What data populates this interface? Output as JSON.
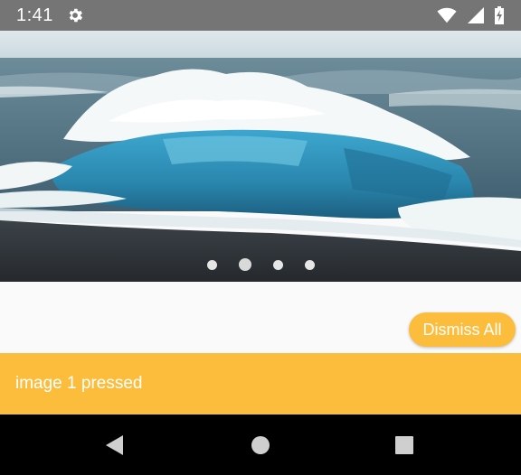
{
  "status_bar": {
    "time": "1:41",
    "icons": [
      "settings-icon",
      "wifi-icon",
      "cellular-signal-icon",
      "battery-charging-icon"
    ]
  },
  "image_slider": {
    "image": "ocean-wave-beach",
    "slide_count": 4,
    "active_slide_index": 1
  },
  "actions": {
    "dismiss_all_label": "Dismiss All"
  },
  "snackbar": {
    "message": "image 1 pressed"
  },
  "navigation_bar": {
    "icons": [
      "back-icon",
      "home-icon",
      "recents-icon"
    ]
  },
  "colors": {
    "accent": "#fbbd3b",
    "status_bar": "#757575",
    "nav_bar": "#000000"
  }
}
